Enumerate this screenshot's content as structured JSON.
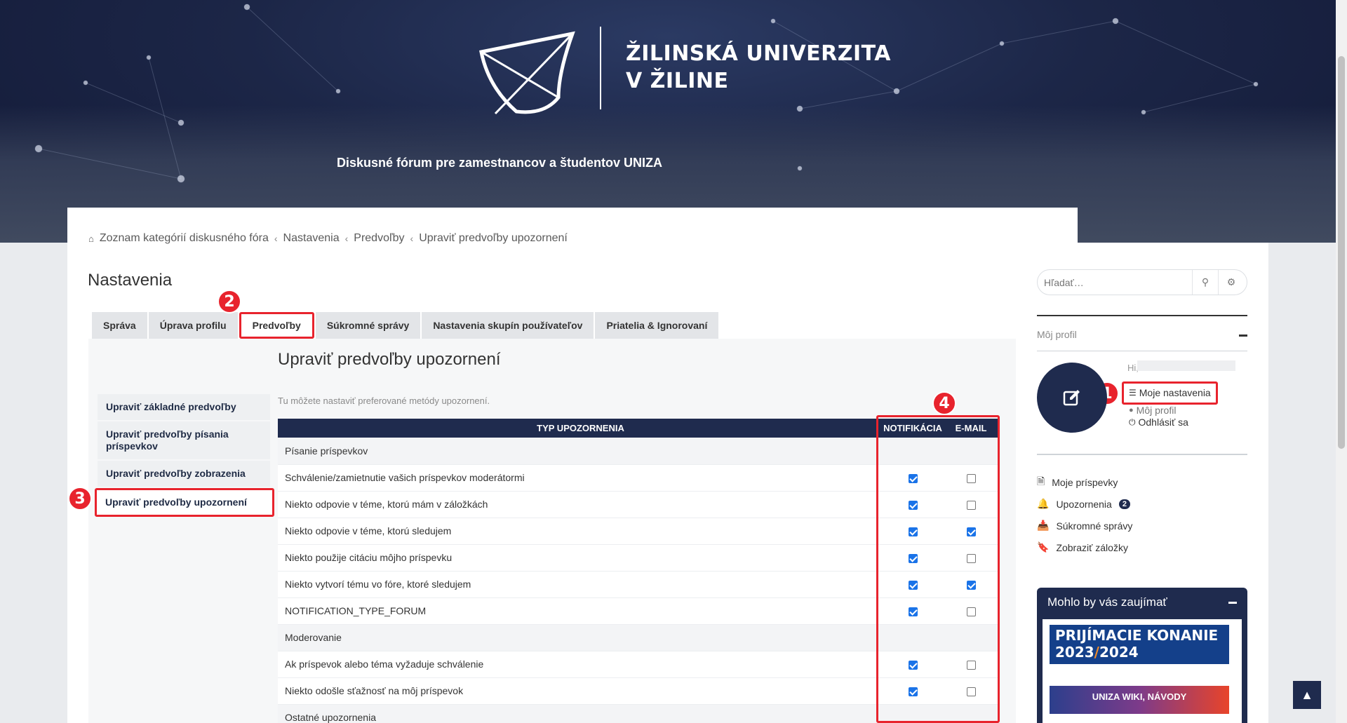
{
  "banner": {
    "logo_line1": "ŽILINSKÁ UNIVERZITA",
    "logo_line2": "V ŽILINE",
    "subtitle": "Diskusné fórum pre zamestnancov a študentov UNIZA"
  },
  "breadcrumb": [
    "Zoznam kategórií diskusného fóra",
    "Nastavenia",
    "Predvoľby",
    "Upraviť predvoľby upozornení"
  ],
  "page_title": "Nastavenia",
  "tabs": [
    {
      "label": "Správa"
    },
    {
      "label": "Úprava profilu"
    },
    {
      "label": "Predvoľby",
      "active": true
    },
    {
      "label": "Súkromné správy"
    },
    {
      "label": "Nastavenia skupín používateľov"
    },
    {
      "label": "Priatelia & Ignorovaní"
    }
  ],
  "section_title": "Upraviť predvoľby upozornení",
  "side_menu": [
    {
      "label": "Upraviť základné predvoľby"
    },
    {
      "label": "Upraviť predvoľby písania príspevkov"
    },
    {
      "label": "Upraviť predvoľby zobrazenia"
    },
    {
      "label": "Upraviť predvoľby upozornení",
      "active": true
    }
  ],
  "intro": "Tu môžete nastaviť preferované metódy upozornení.",
  "table": {
    "headers": [
      "TYP UPOZORNENIA",
      "NOTIFIKÁCIA",
      "E-MAIL"
    ],
    "rows": [
      {
        "type": "group",
        "label": "Písanie príspevkov"
      },
      {
        "label": "Schválenie/zamietnutie vašich príspevkov moderátormi",
        "notif": true,
        "email": false
      },
      {
        "label": "Niekto odpovie v téme, ktorú mám v záložkách",
        "notif": true,
        "email": false
      },
      {
        "label": "Niekto odpovie v téme, ktorú sledujem",
        "notif": true,
        "email": true
      },
      {
        "label": "Niekto použije citáciu môjho príspevku",
        "notif": true,
        "email": false
      },
      {
        "label": "Niekto vytvorí tému vo fóre, ktoré sledujem",
        "notif": true,
        "email": true
      },
      {
        "label": "NOTIFICATION_TYPE_FORUM",
        "notif": true,
        "email": false
      },
      {
        "type": "group",
        "label": "Moderovanie"
      },
      {
        "label": "Ak príspevok alebo téma vyžaduje schválenie",
        "notif": true,
        "email": false
      },
      {
        "label": "Niekto odošle sťažnosť na môj príspevok",
        "notif": true,
        "email": false
      },
      {
        "type": "group",
        "label": "Ostatné upozornenia"
      }
    ]
  },
  "sidebar": {
    "search_placeholder": "Hľadať…",
    "my_profile": "Môj profil",
    "hi": "Hi,",
    "profile_links": [
      "Moje nastavenia",
      "Môj profil",
      "Odhlásiť sa"
    ],
    "user_links": [
      {
        "label": "Moje príspevky",
        "icon": "file-icon"
      },
      {
        "label": "Upozornenia",
        "icon": "bell-icon",
        "badge": "2"
      },
      {
        "label": "Súkromné správy",
        "icon": "inbox-icon"
      },
      {
        "label": "Zobraziť záložky",
        "icon": "bookmark-icon"
      }
    ],
    "interest_title": "Mohlo by vás zaujímať",
    "promo1_line1": "PRIJÍMACIE KONANIE",
    "promo1_year1": "2023",
    "promo1_slash": "/",
    "promo1_year2": "2024",
    "promo2": "UNIZA WIKI, NÁVODY"
  },
  "markers": [
    "1",
    "2",
    "3",
    "4"
  ],
  "colors": {
    "accent": "#1f2b4e",
    "highlight": "#e8232d",
    "checkbox": "#1a73e8"
  }
}
